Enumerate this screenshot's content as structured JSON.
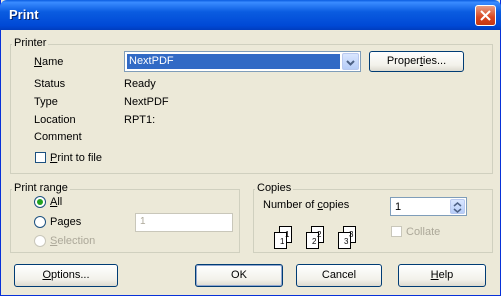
{
  "window": {
    "title": "Print"
  },
  "printer": {
    "legend": "Printer",
    "name_label_prefix": "",
    "name_label_u": "N",
    "name_label_rest": "ame",
    "name_value": "NextPDF",
    "properties_pre": "Proper",
    "properties_u": "t",
    "properties_post": "ies...",
    "status_label": "Status",
    "status_value": "Ready",
    "type_label": "Type",
    "type_value": "NextPDF",
    "location_label": "Location",
    "location_value": "RPT1:",
    "comment_label": "Comment",
    "print_to_file_u": "P",
    "print_to_file_rest": "rint to file"
  },
  "print_range": {
    "legend": "Print range",
    "all_u": "A",
    "all_rest": "ll",
    "pages_pre": "Pa",
    "pages_u": "g",
    "pages_post": "es",
    "pages_value": "1",
    "selection_u": "S",
    "selection_rest": "election",
    "selected": "all"
  },
  "copies": {
    "legend": "Copies",
    "number_pre": "Number of ",
    "number_u": "c",
    "number_post": "opies",
    "value": "1",
    "collate_label": "Collate",
    "pages": [
      "1",
      "1",
      "2",
      "2",
      "3",
      "3"
    ]
  },
  "buttons": {
    "options_u": "O",
    "options_rest": "ptions...",
    "ok": "OK",
    "cancel": "Cancel",
    "help_u": "H",
    "help_rest": "elp"
  }
}
